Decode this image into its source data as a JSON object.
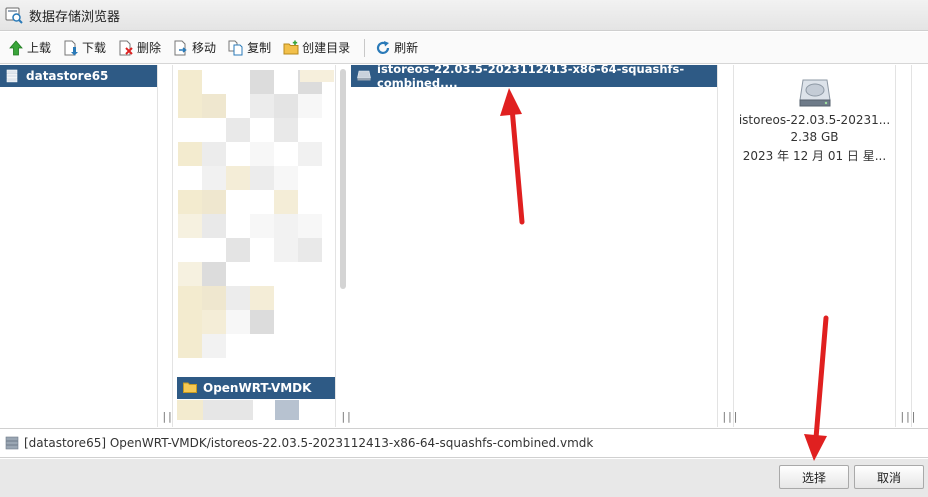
{
  "window": {
    "title": "数据存储浏览器"
  },
  "toolbar": {
    "items": [
      {
        "label": "上载"
      },
      {
        "label": "下载"
      },
      {
        "label": "删除"
      },
      {
        "label": "移动"
      },
      {
        "label": "复制"
      },
      {
        "label": "创建目录"
      },
      {
        "label": "刷新"
      }
    ]
  },
  "columns": {
    "datastore": {
      "selected": "datastore65"
    },
    "folders": {
      "selected": "OpenWRT-VMDK"
    },
    "files": {
      "selected": "istoreos-22.03.5-2023112413-x86-64-squashfs-combined...."
    },
    "resize_glyph": "|||"
  },
  "preview": {
    "name": "istoreos-22.03.5-20231...",
    "size": "2.38 GB",
    "date": "2023 年 12 月 01 日 星..."
  },
  "pathbar": {
    "path": "[datastore65] OpenWRT-VMDK/istoreos-22.03.5-2023112413-x86-64-squashfs-combined.vmdk"
  },
  "footer": {
    "select_label": "选择",
    "cancel_label": "取消"
  },
  "colors": {
    "selection": "#2e5a85",
    "annotation": "#e02020"
  }
}
